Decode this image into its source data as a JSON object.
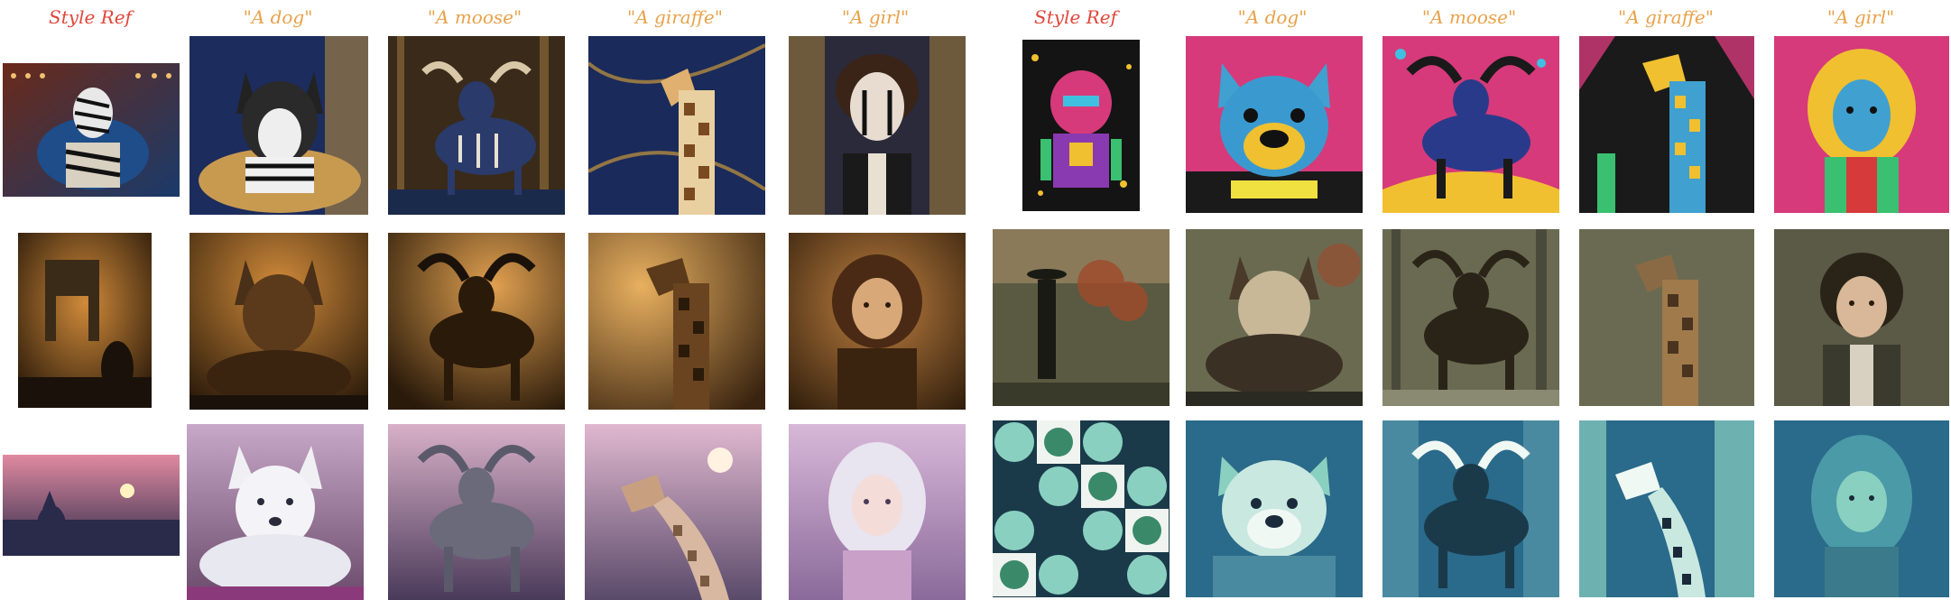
{
  "headers": [
    "Style Ref",
    "\"A dog\"",
    "\"A moose\"",
    "\"A giraffe\"",
    "\"A girl\"",
    "Style Ref",
    "\"A dog\"",
    "\"A moose\"",
    "\"A giraffe\"",
    "\"A girl\""
  ],
  "colors": {
    "style_ref_label": "#e0463a",
    "prompt_label": "#e8a24a",
    "rows": [
      {
        "left": [
          "#2a3a6a",
          "#c8a060",
          "#1a1a1a"
        ],
        "right": [
          "#d63a7a",
          "#1a1a1a",
          "#f0c030"
        ]
      },
      {
        "left": [
          "#3a2a18",
          "#d08a3a",
          "#1a120a"
        ],
        "right": [
          "#5a5a42",
          "#8a7a5a",
          "#2a2a22"
        ]
      },
      {
        "left": [
          "#6a5a8a",
          "#e0a0b8",
          "#2a2a4a"
        ],
        "right": [
          "#2a6a8a",
          "#8ad0c0",
          "#1a3a4a"
        ]
      }
    ]
  }
}
